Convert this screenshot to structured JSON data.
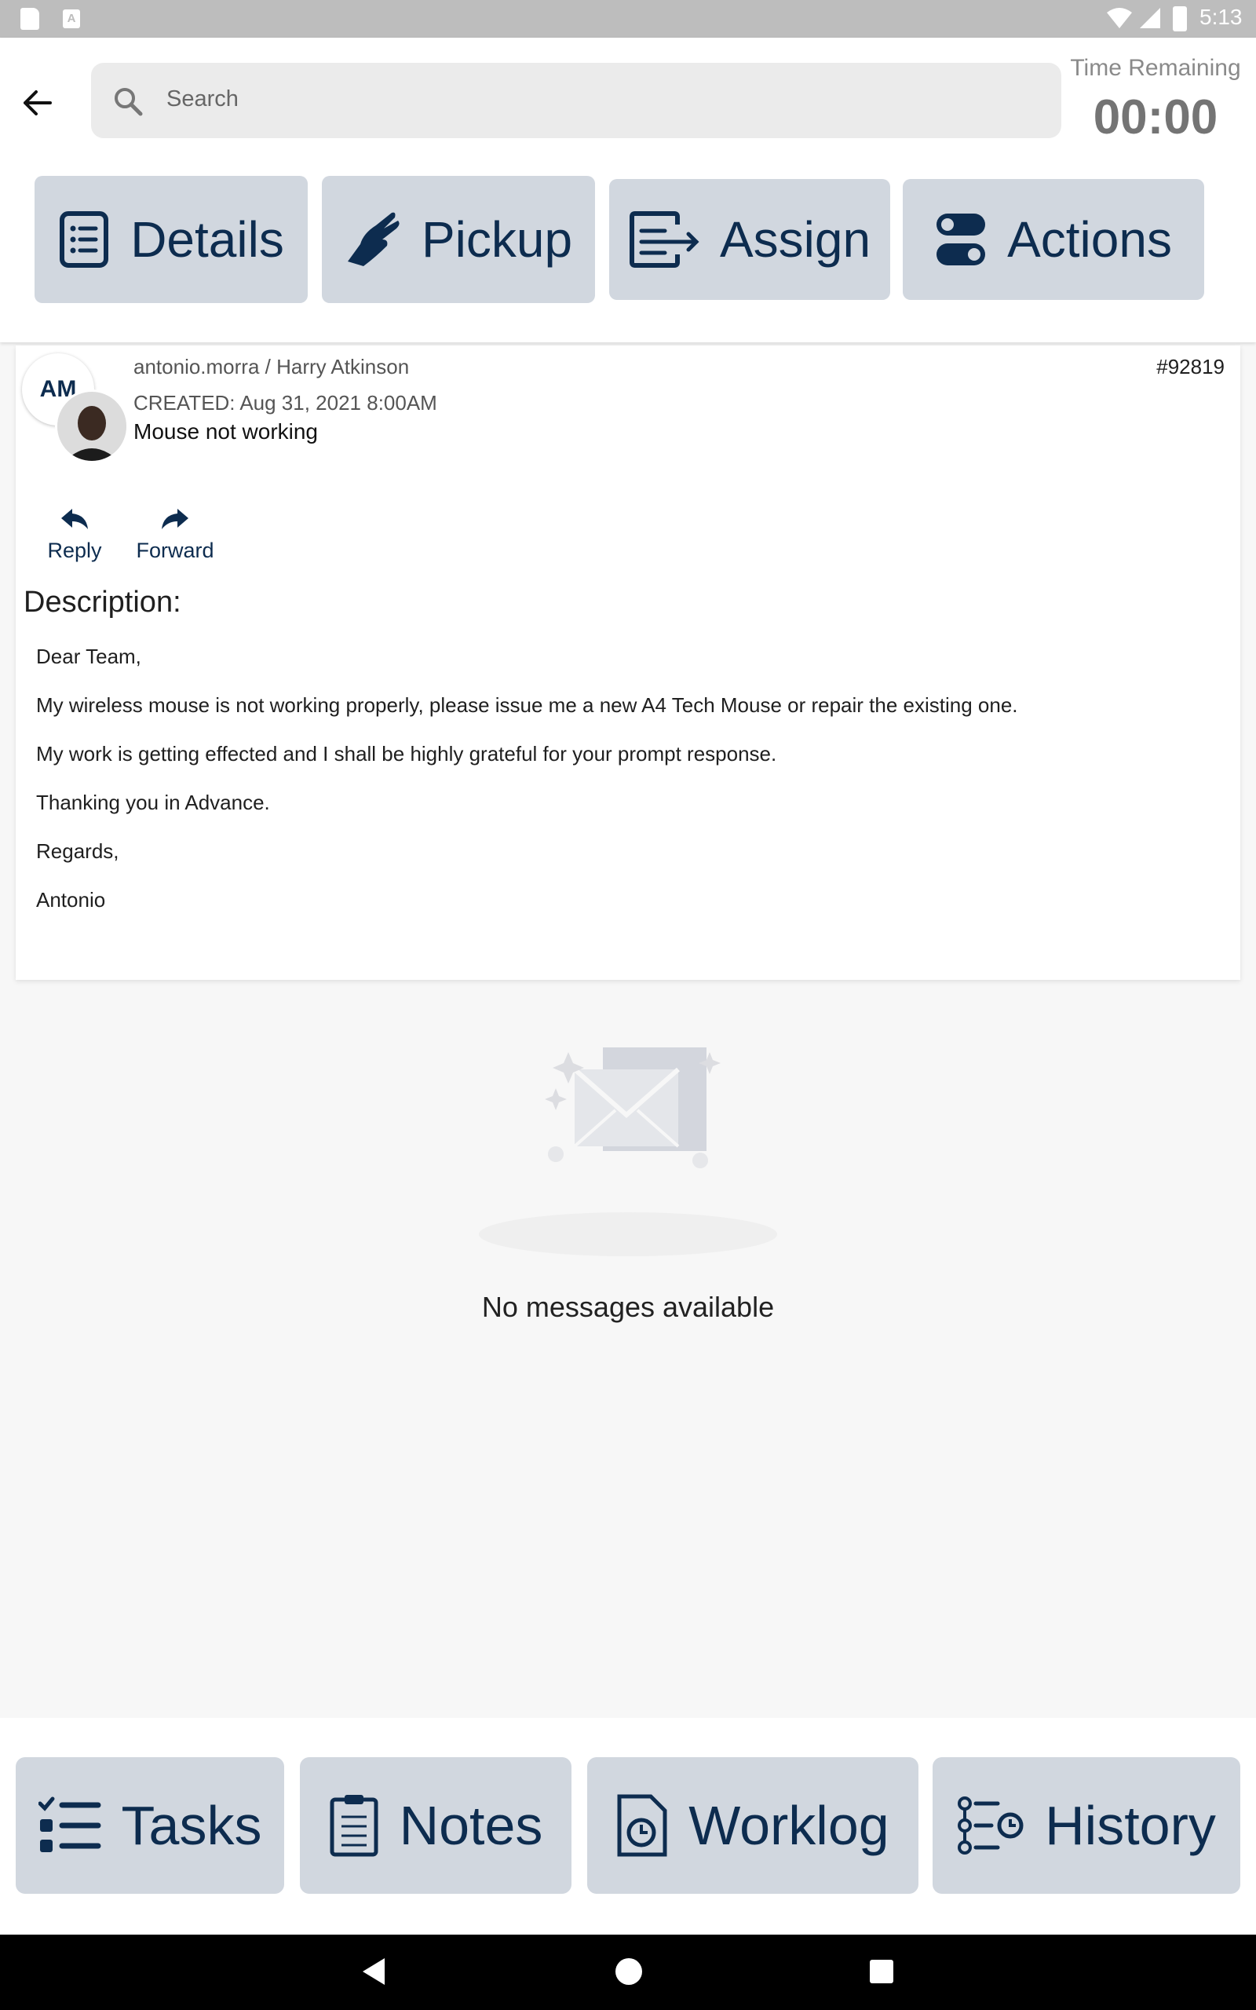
{
  "status_bar": {
    "time": "5:13",
    "a_icon_letter": "A"
  },
  "header": {
    "search": {
      "placeholder": "Search"
    },
    "time_remaining": {
      "label": "Time Remaining",
      "value": "00:00"
    },
    "actions": {
      "details": "Details",
      "pickup": "Pickup",
      "assign": "Assign",
      "actions": "Actions"
    }
  },
  "ticket": {
    "initials": "AM",
    "users": "antonio.morra / Harry Atkinson",
    "id": "#92819",
    "created": "CREATED: Aug 31, 2021 8:00AM",
    "subject": "Mouse not working",
    "reply_label": "Reply",
    "forward_label": "Forward",
    "description_title": "Description:",
    "description_lines": [
      "Dear Team,",
      "My wireless mouse is not working properly, please issue me a new A4 Tech Mouse or repair the existing one.",
      "My work is getting effected and I shall be highly grateful for your prompt response.",
      "Thanking you in Advance.",
      "Regards,",
      "Antonio"
    ]
  },
  "messages": {
    "empty_text": "No messages available"
  },
  "bottom_tabs": {
    "tasks": "Tasks",
    "notes": "Notes",
    "worklog": "Worklog",
    "history": "History"
  },
  "colors": {
    "accent": "#0d2c4f",
    "button_bg": "#d1d7df",
    "status_bar": "#bdbdbd"
  }
}
